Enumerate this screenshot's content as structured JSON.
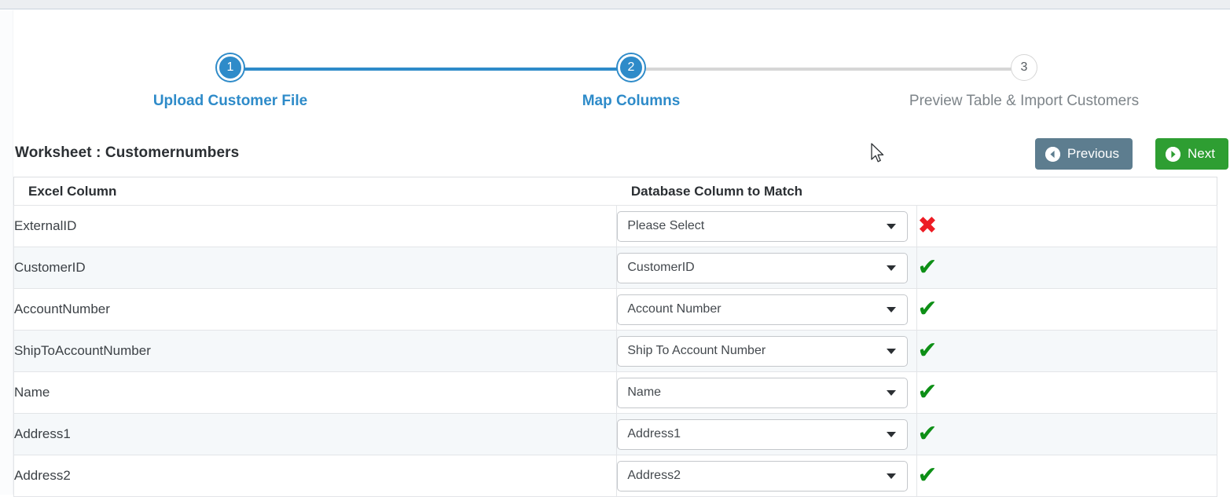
{
  "wizard": {
    "steps": [
      {
        "number": "1",
        "label": "Upload Customer File",
        "state": "active"
      },
      {
        "number": "2",
        "label": "Map Columns",
        "state": "active"
      },
      {
        "number": "3",
        "label": "Preview Table & Import Customers",
        "state": "inactive"
      }
    ],
    "active_step": 2,
    "colors": {
      "active": "#2e8bc9",
      "inactive": "#d6d6d6",
      "inactive_text": "#7d8489"
    }
  },
  "toolbar": {
    "worksheet_title": "Worksheet : Customernumbers",
    "previous_label": "Previous",
    "next_label": "Next",
    "previous_color": "#5d7d8f",
    "next_color": "#2e9e32"
  },
  "table": {
    "headers": {
      "excel": "Excel Column",
      "database": "Database Column to Match",
      "status": ""
    },
    "rows": [
      {
        "excel": "ExternalID",
        "database": "Please Select",
        "status": "bad"
      },
      {
        "excel": "CustomerID",
        "database": "CustomerID",
        "status": "ok"
      },
      {
        "excel": "AccountNumber",
        "database": "Account Number",
        "status": "ok"
      },
      {
        "excel": "ShipToAccountNumber",
        "database": "Ship To Account Number",
        "status": "ok"
      },
      {
        "excel": "Name",
        "database": "Name",
        "status": "ok"
      },
      {
        "excel": "Address1",
        "database": "Address1",
        "status": "ok"
      },
      {
        "excel": "Address2",
        "database": "Address2",
        "status": "ok"
      }
    ],
    "status_glyphs": {
      "ok": "✔",
      "bad": "✖"
    },
    "status_colors": {
      "ok": "#0d8f16",
      "bad": "#ed1c24"
    }
  },
  "icons": {
    "previous": "circle-left-arrow-icon",
    "next": "circle-right-arrow-icon",
    "dropdown": "caret-down-icon",
    "cursor": "mouse-pointer-icon"
  }
}
